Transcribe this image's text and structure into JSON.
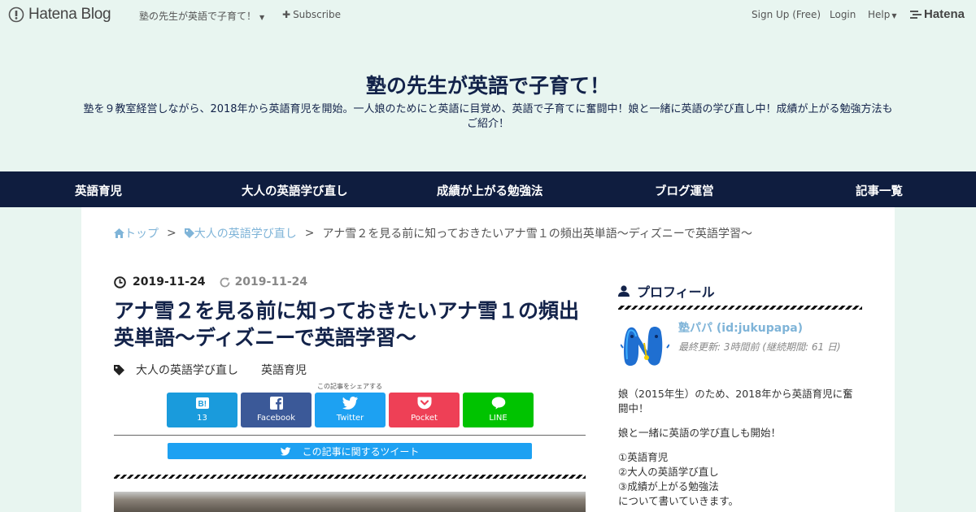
{
  "topbar": {
    "logo_text": "Hatena Blog",
    "blog_menu": "塾の先生が英語で子育て！",
    "subscribe": "Subscribe",
    "signup": "Sign Up (Free)",
    "login": "Login",
    "help": "Help",
    "hatena": "Hatena"
  },
  "header": {
    "title": "塾の先生が英語で子育て！",
    "description": "塾を９教室経営しながら、2018年から英語育児を開始。一人娘のためにと英語に目覚め、英語で子育てに奮闘中！娘と一緒に英語の学び直し中！成績が上がる勉強方法もご紹介！"
  },
  "nav": [
    "英語育児",
    "大人の英語学び直し",
    "成績が上がる勉強法",
    "ブログ運営",
    "記事一覧"
  ],
  "breadcrumb": {
    "top": "トップ",
    "category": "大人の英語学び直し",
    "current": "アナ雪２を見る前に知っておきたいアナ雪１の頻出英単語～ディズニーで英語学習～"
  },
  "entry": {
    "posted_date": "2019-11-24",
    "updated_date": "2019-11-24",
    "title": "アナ雪２を見る前に知っておきたいアナ雪１の頻出英単語～ディズニーで英語学習～",
    "categories": [
      "大人の英語学び直し",
      "英語育児"
    ]
  },
  "share": {
    "caption": "この記事をシェアする",
    "hatebu_count": "13",
    "facebook": "Facebook",
    "twitter": "Twitter",
    "pocket": "Pocket",
    "line": "LINE",
    "tweet_related": "この記事に関するツイート"
  },
  "sidebar": {
    "profile_heading": "プロフィール",
    "name": "塾パパ (id:jukupapa)",
    "updated": "最終更新: 3時間前 (継続期間: 61 日)",
    "p1": "娘（2015年生）のため、2018年から英語育児に奮闘中！",
    "p2": "娘と一緒に英語の学び直しも開始！",
    "list": [
      "①英語育児",
      "②大人の英語学び直し",
      "③成績が上がる勉強法",
      "について書いていきます。"
    ]
  },
  "colors": {
    "nav_bg": "#0f1d3f",
    "page_bg": "#e8f5f0",
    "title": "#13234a",
    "link": "#7fb4d8",
    "hatebu": "#1a9bdc",
    "facebook": "#3b5998",
    "twitter": "#1da1f2",
    "pocket": "#ee4056",
    "line": "#00c300"
  },
  "icons": [
    "hatena-blog-logo-icon",
    "plus-icon",
    "hatena-logo-icon",
    "home-icon",
    "tag-icon",
    "clock-icon",
    "refresh-icon",
    "hatebu-icon",
    "facebook-icon",
    "twitter-icon",
    "pocket-icon",
    "line-icon",
    "user-icon"
  ]
}
